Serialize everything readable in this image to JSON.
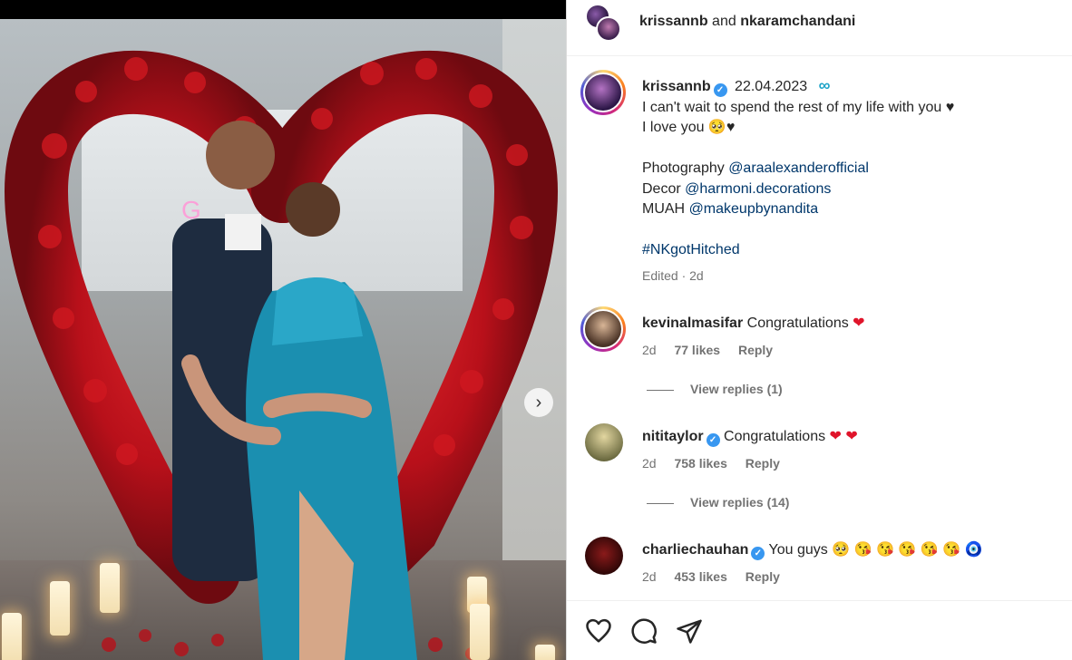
{
  "post": {
    "header_users": "krissannb",
    "header_and": "and",
    "header_coauthor": "nkaramchandani",
    "author": "krissannb",
    "date": "22.04.2023",
    "infinity_glyph": "∞",
    "caption_line1": "I can't wait to spend the rest of my life with you ♥",
    "caption_line2": "I love you 🥺♥",
    "credit1_label": "Photography",
    "credit1_handle": "@araalexanderofficial",
    "credit2_label": "Decor",
    "credit2_handle": "@harmoni.decorations",
    "credit3_label": "MUAH",
    "credit3_handle": "@makeupbynandita",
    "hashtag": "#NKgotHitched",
    "edited": "Edited · 2d"
  },
  "comments": [
    {
      "user": "kevinalmasifar",
      "verified": false,
      "text": "Congratulations",
      "emoji": "❤",
      "age": "2d",
      "likes": "77 likes",
      "reply": "Reply",
      "view_replies": "View replies (1)"
    },
    {
      "user": "nititaylor",
      "verified": true,
      "text": "Congratulations",
      "emoji": "❤ ❤",
      "age": "2d",
      "likes": "758 likes",
      "reply": "Reply",
      "view_replies": "View replies (14)"
    },
    {
      "user": "charliechauhan",
      "verified": true,
      "text": "You guys",
      "emoji": "🥺 😘 😘 😘 😘 😘 🧿",
      "age": "2d",
      "likes": "453 likes",
      "reply": "Reply"
    }
  ],
  "verified_glyph": "✓",
  "next_glyph": "›",
  "icons": [
    "heart-icon",
    "comment-icon",
    "share-icon",
    "next-arrow-icon",
    "verified-icon"
  ],
  "colors": {
    "link": "#00376b",
    "verified": "#3897f0",
    "heart": "#e0142a",
    "muted": "#737373"
  }
}
